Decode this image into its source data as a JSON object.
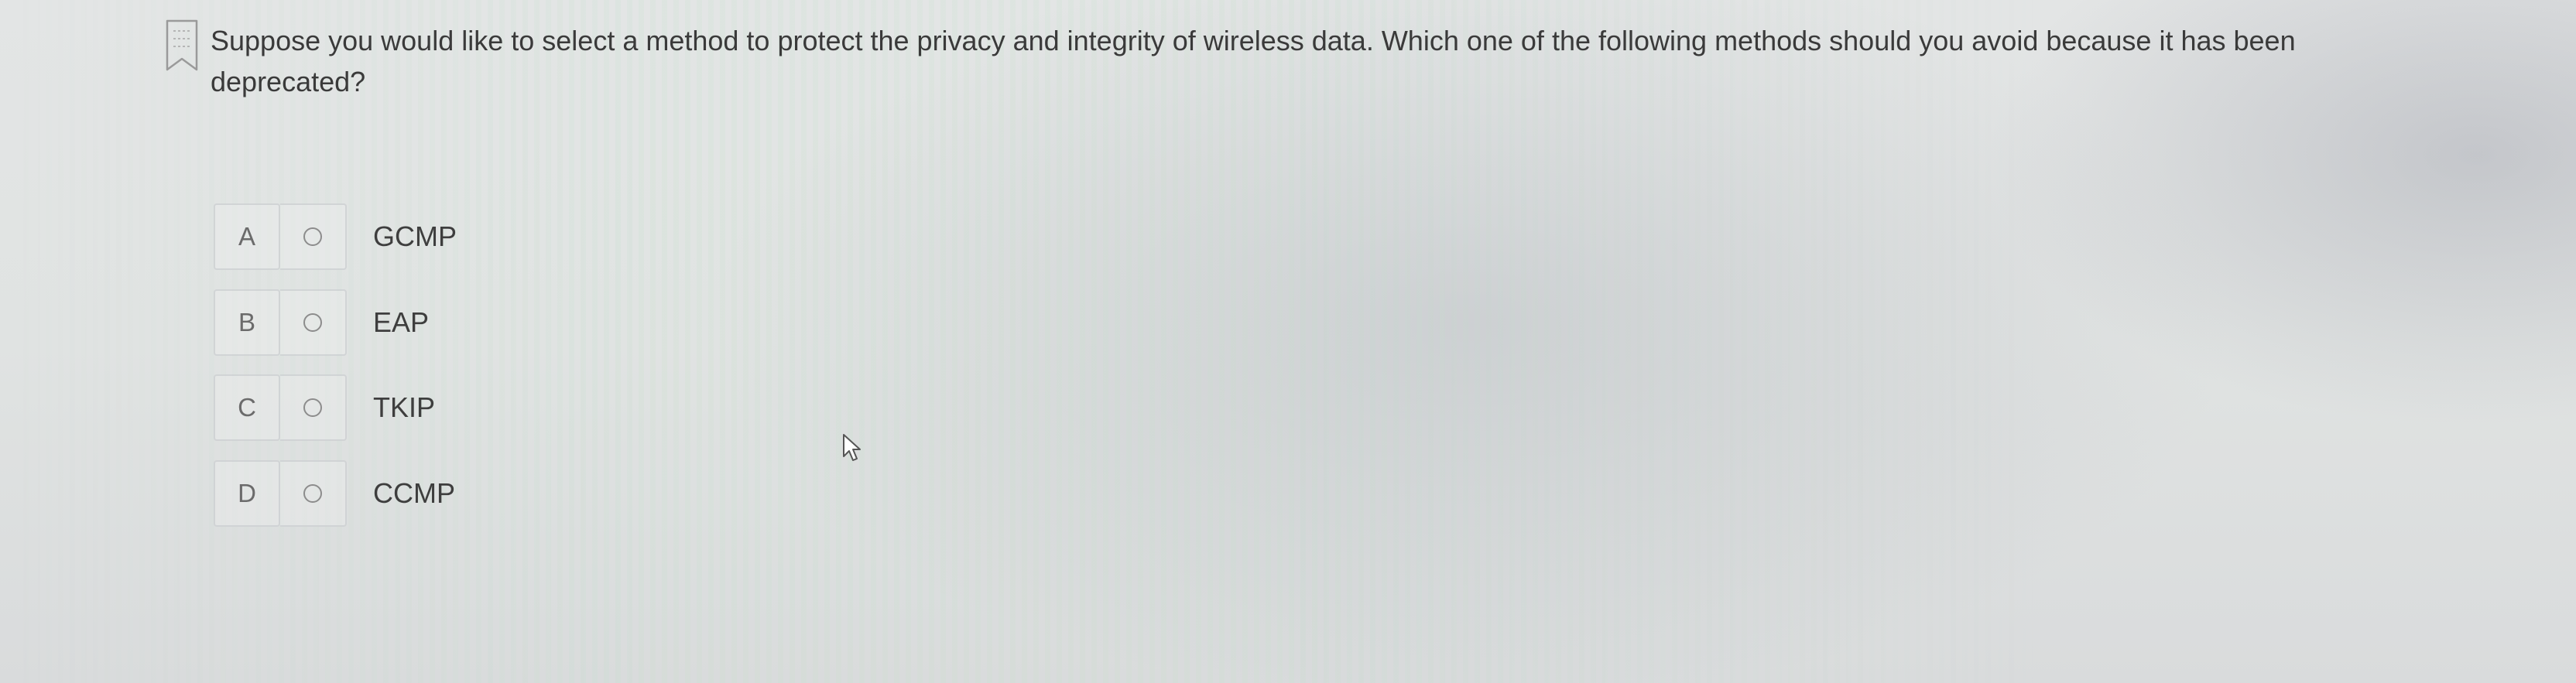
{
  "question": {
    "text": "Suppose you would like to select a method to protect the privacy and integrity of wireless data. Which one of the following methods should you avoid because it has been deprecated?",
    "bookmark_icon": "bookmark-icon"
  },
  "options": [
    {
      "letter": "A",
      "label": "GCMP",
      "selected": false
    },
    {
      "letter": "B",
      "label": "EAP",
      "selected": false
    },
    {
      "letter": "C",
      "label": "TKIP",
      "selected": false
    },
    {
      "letter": "D",
      "label": "CCMP",
      "selected": false
    }
  ],
  "colors": {
    "text": "#3a3a3a",
    "option_border": "#c8cbcd",
    "radio": "#8c8c8c",
    "background": "#e1e3e3"
  }
}
